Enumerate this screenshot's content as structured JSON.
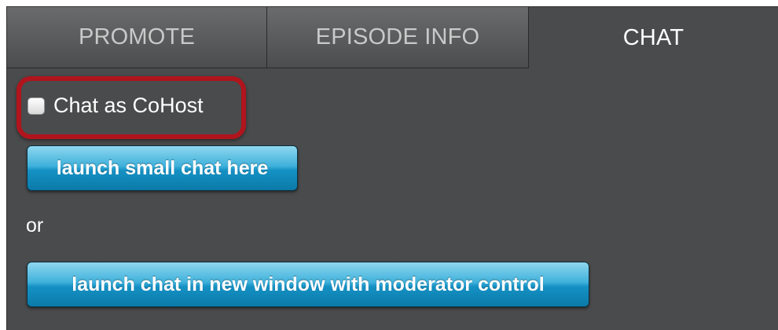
{
  "tabs": [
    {
      "label": "PROMOTE",
      "active": false
    },
    {
      "label": "EPISODE INFO",
      "active": false
    },
    {
      "label": "CHAT",
      "active": true
    }
  ],
  "chat": {
    "cohost_label": "Chat as CoHost",
    "cohost_checked": false,
    "small_chat_button": "launch small chat here",
    "or_text": "or",
    "new_window_button": "launch chat in new window with moderator control"
  },
  "colors": {
    "panel_bg": "#4a4b4c",
    "highlight_border": "#b0141c",
    "button_blue": "#1591c4"
  }
}
